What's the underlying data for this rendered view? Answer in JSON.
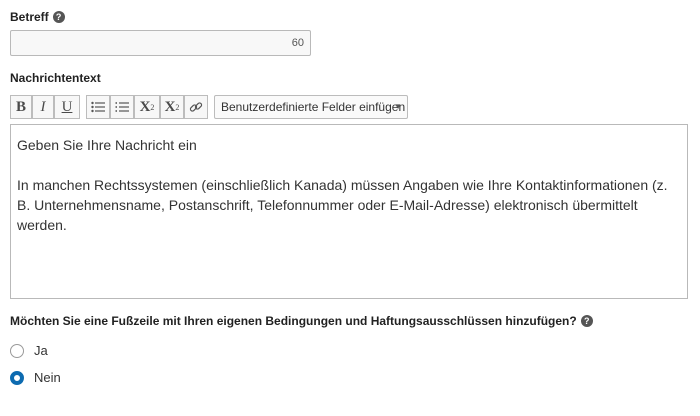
{
  "subject": {
    "label": "Betreff",
    "help_icon": "?",
    "char_count": "60"
  },
  "message": {
    "label": "Nachrichtentext",
    "toolbar": {
      "bold": "B",
      "italic": "I",
      "underline": "U",
      "bulleted_list_icon": "bulleted-list-icon",
      "numbered_list_icon": "numbered-list-icon",
      "superscript": "X",
      "superscript_mark": "2",
      "subscript": "X",
      "subscript_mark": "2",
      "link_icon": "link-icon",
      "custom_fields_dropdown": "Benutzerdefinierte Felder einfügen"
    },
    "body_line1": "Geben Sie Ihre Nachricht ein",
    "body_line2": "In manchen Rechtssystemen (einschließlich Kanada) müssen Angaben wie Ihre Kontaktinformationen (z. B. Unternehmensname, Postanschrift, Telefonnummer oder E-Mail-Adresse) elektronisch übermittelt werden."
  },
  "footer_question": {
    "label": "Möchten Sie eine Fußzeile mit Ihren eigenen Bedingungen und Haftungsausschlüssen hinzufügen?",
    "help_icon": "?",
    "options": [
      {
        "label": "Ja",
        "selected": false
      },
      {
        "label": "Nein",
        "selected": true
      }
    ]
  },
  "colors": {
    "accent": "#0d6bb0",
    "border": "#b9b9b9"
  }
}
